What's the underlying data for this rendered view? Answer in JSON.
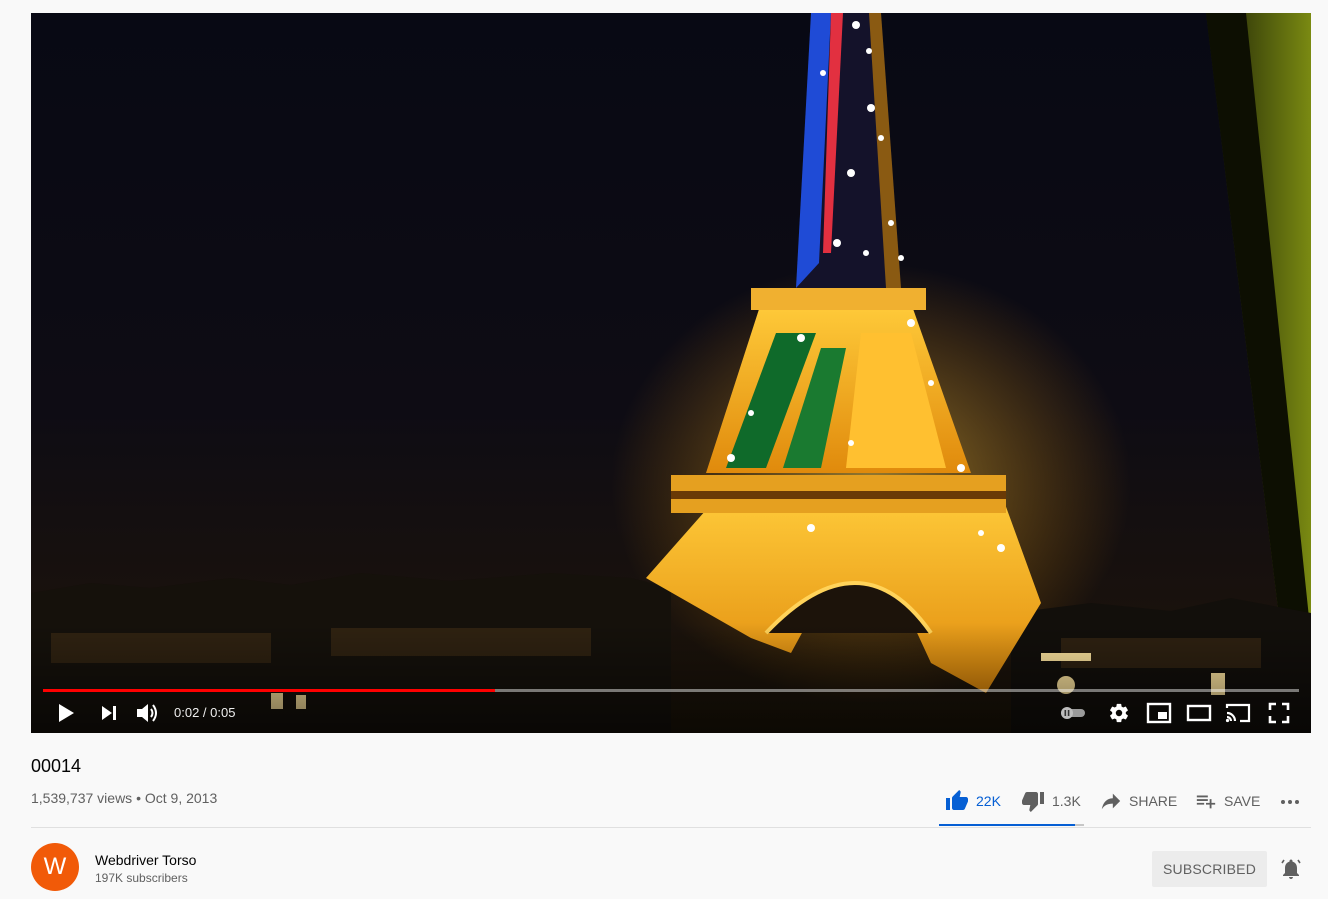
{
  "player": {
    "current_time": "0:02",
    "duration": "0:05",
    "time_separator": " / ",
    "progress_fraction": 0.36,
    "autoplay_on": false
  },
  "video": {
    "title": "00014",
    "views": "1,539,737 views",
    "separator": " • ",
    "date": "Oct 9, 2013"
  },
  "actions": {
    "like_count": "22K",
    "dislike_count": "1.3K",
    "share_label": "SHARE",
    "save_label": "SAVE",
    "like_ratio": 0.94
  },
  "channel": {
    "avatar_letter": "W",
    "name": "Webdriver Torso",
    "subscribers": "197K subscribers",
    "subscribe_label": "SUBSCRIBED"
  },
  "colors": {
    "accent_red": "#ff0000",
    "like_blue": "#065fd4",
    "avatar_orange": "#f15a08"
  },
  "icons": [
    "play-icon",
    "next-icon",
    "volume-icon",
    "autoplay-toggle-icon",
    "settings-gear-icon",
    "miniplayer-icon",
    "theater-mode-icon",
    "cast-icon",
    "fullscreen-icon",
    "thumbs-up-icon",
    "thumbs-down-icon",
    "share-arrow-icon",
    "playlist-add-icon",
    "more-horizontal-icon",
    "bell-icon"
  ]
}
